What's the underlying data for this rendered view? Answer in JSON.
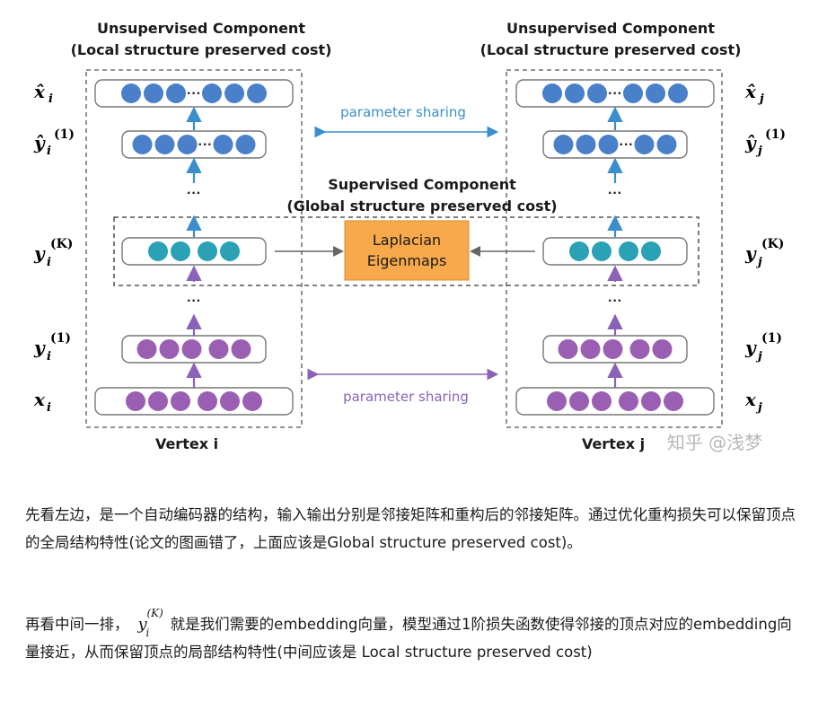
{
  "diagram": {
    "left_component_title_line1": "Unsupervised Component",
    "left_component_title_line2": "(Local structure preserved cost)",
    "right_component_title_line1": "Unsupervised Component",
    "right_component_title_line2": "(Local structure preserved cost)",
    "supervised_title_line1": "Supervised Component",
    "supervised_title_line2": "(Global structure preserved cost)",
    "laplacian_line1": "Laplacian",
    "laplacian_line2": "Eigenmaps",
    "parameter_sharing_top": "parameter sharing",
    "parameter_sharing_bottom": "parameter sharing",
    "vertex_i": "Vertex i",
    "vertex_j": "Vertex j",
    "watermark": "知乎 @浅梦",
    "ellipsis": "···",
    "left_labels": {
      "xhat_base": "x̂",
      "xhat_sub": "i",
      "yhat_base": "ŷ",
      "yhat_sub": "i",
      "yhat_sup": "(1)",
      "yK_base": "y",
      "yK_sub": "i",
      "yK_sup": "(K)",
      "y1_base": "y",
      "y1_sub": "i",
      "y1_sup": "(1)",
      "x_base": "x",
      "x_sub": "i"
    },
    "right_labels": {
      "xhat_base": "x̂",
      "xhat_sub": "j",
      "yhat_base": "ŷ",
      "yhat_sub": "j",
      "yhat_sup": "(1)",
      "yK_base": "y",
      "yK_sub": "j",
      "yK_sup": "(K)",
      "y1_base": "y",
      "y1_sub": "j",
      "y1_sup": "(1)",
      "x_base": "x",
      "x_sub": "j"
    },
    "colors": {
      "blue_node": "#4a7fc9",
      "teal_node": "#2aa1b5",
      "purple_node": "#9a5fb3",
      "laplacian_fill": "#f7a94b",
      "blue_arrow": "#3a8ecb",
      "purple_arrow": "#8a62b8",
      "dashed": "#555555"
    }
  },
  "text": {
    "para1": "先看左边，是一个自动编码器的结构，输入输出分别是邻接矩阵和重构后的邻接矩阵。通过优化重构损失可以保留顶点的全局结构特性(论文的图画错了，上面应该是Global structure preserved cost)。",
    "para2_before": "再看中间一排，",
    "para2_math_base": "y",
    "para2_math_sub": "i",
    "para2_math_sup": "(K)",
    "para2_after": "就是我们需要的embedding向量，模型通过1阶损失函数使得邻接的顶点对应的embedding向量接近，从而保留顶点的局部结构特性(中间应该是 Local structure preserved cost)"
  }
}
